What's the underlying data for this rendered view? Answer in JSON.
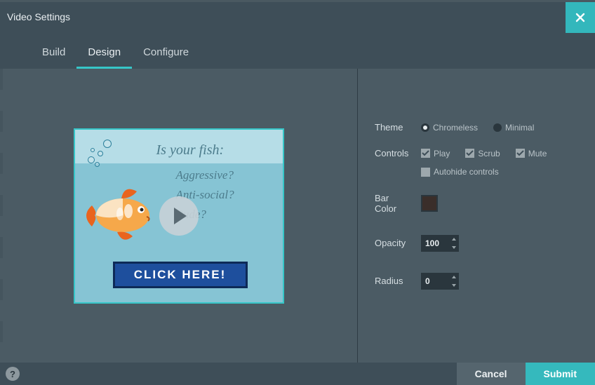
{
  "modal": {
    "title": "Video Settings"
  },
  "tabs": [
    {
      "label": "Build",
      "active": false
    },
    {
      "label": "Design",
      "active": true
    },
    {
      "label": "Configure",
      "active": false
    }
  ],
  "preview": {
    "headline": "Is your fish:",
    "lines": [
      "Aggressive?",
      "Anti-social?",
      "Rude?"
    ],
    "cta": "CLICK HERE!"
  },
  "settings": {
    "theme": {
      "label": "Theme",
      "options": [
        {
          "label": "Chromeless",
          "selected": true
        },
        {
          "label": "Minimal",
          "selected": false
        }
      ]
    },
    "controls": {
      "label": "Controls",
      "options": [
        {
          "label": "Play",
          "checked": true
        },
        {
          "label": "Scrub",
          "checked": true
        },
        {
          "label": "Mute",
          "checked": true
        }
      ],
      "autohide": {
        "label": "Autohide controls",
        "checked": false
      }
    },
    "barcolor": {
      "label": "Bar Color",
      "value": "#3a2e2a"
    },
    "opacity": {
      "label": "Opacity",
      "value": "100"
    },
    "radius": {
      "label": "Radius",
      "value": "0"
    }
  },
  "footer": {
    "cancel": "Cancel",
    "submit": "Submit"
  }
}
